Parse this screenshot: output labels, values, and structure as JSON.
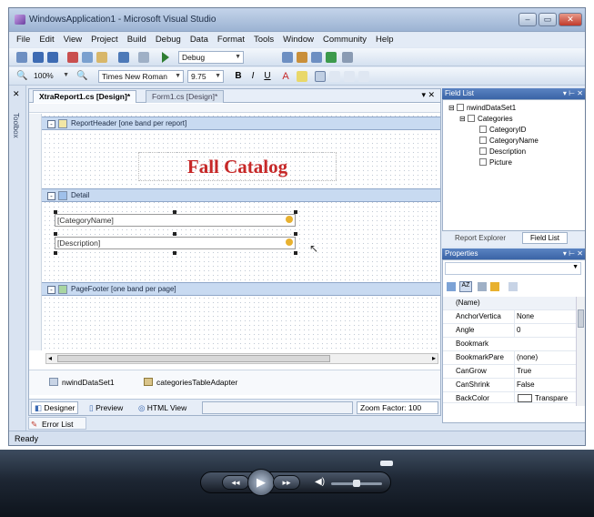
{
  "window": {
    "title": "WindowsApplication1 - Microsoft Visual Studio"
  },
  "menu": [
    "File",
    "Edit",
    "View",
    "Project",
    "Build",
    "Debug",
    "Data",
    "Format",
    "Tools",
    "Window",
    "Community",
    "Help"
  ],
  "toolbar1": {
    "config": "Debug"
  },
  "toolbar2": {
    "zoom": "100%",
    "font": "Times New Roman",
    "size": "9.75"
  },
  "toolbox_label": "Toolbox",
  "doc_tabs": [
    "XtraReport1.cs [Design]*",
    "Form1.cs [Design]*"
  ],
  "bands": {
    "header": "ReportHeader [one band per report]",
    "detail": "Detail",
    "footer": "PageFooter [one band per page]"
  },
  "catalog_title": "Fall Catalog",
  "fields": [
    "[CategoryName]",
    "[Description]"
  ],
  "tray": {
    "dataset": "nwindDataSet1",
    "adapter": "categoriesTableAdapter"
  },
  "bottom_tabs": [
    "Designer",
    "Preview",
    "HTML View"
  ],
  "zoom_factor": "Zoom Factor: 100",
  "error_list": "Error List",
  "field_list": {
    "title": "Field List",
    "dataset": "nwindDataSet1",
    "table": "Categories",
    "columns": [
      "CategoryID",
      "CategoryName",
      "Description",
      "Picture"
    ],
    "tabs": [
      "Report Explorer",
      "Field List"
    ]
  },
  "properties": {
    "title": "Properties",
    "rows": [
      {
        "name": "(Name)",
        "value": ""
      },
      {
        "name": "AnchorVertica",
        "value": "None"
      },
      {
        "name": "Angle",
        "value": "0"
      },
      {
        "name": "Bookmark",
        "value": ""
      },
      {
        "name": "BookmarkPare",
        "value": "(none)"
      },
      {
        "name": "CanGrow",
        "value": "True"
      },
      {
        "name": "CanShrink",
        "value": "False"
      },
      {
        "name": "BackColor",
        "value": "Transpare"
      }
    ]
  },
  "status": "Ready"
}
